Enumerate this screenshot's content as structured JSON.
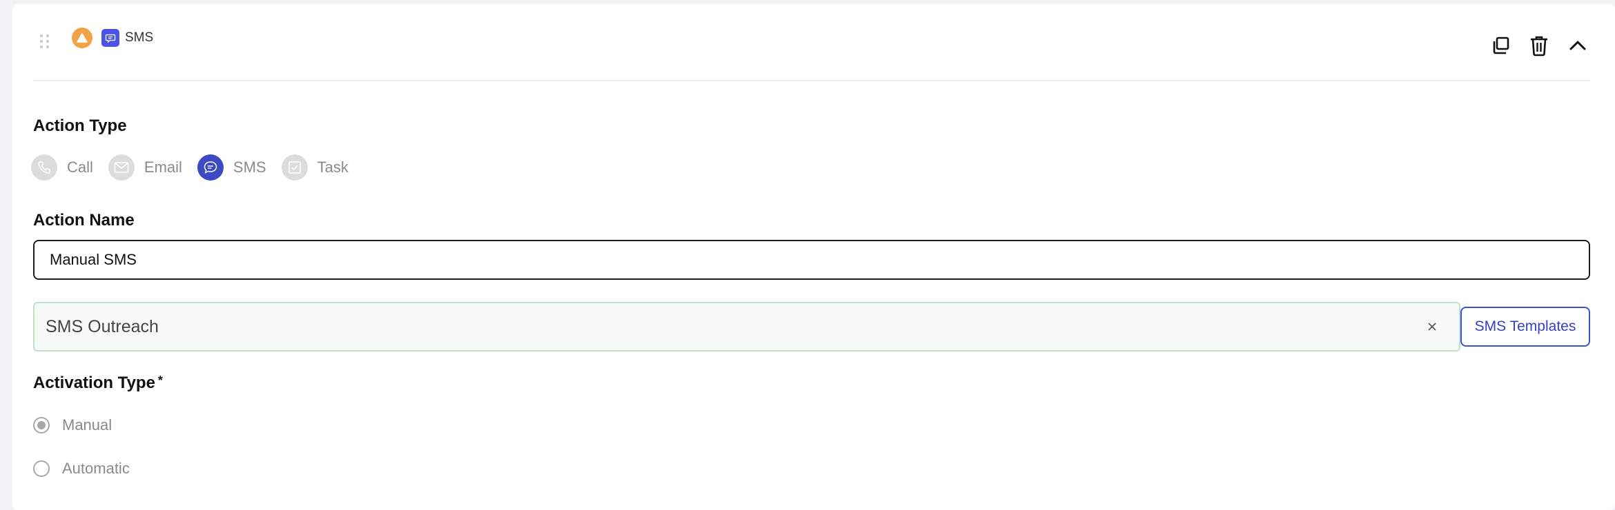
{
  "header": {
    "title": "SMS",
    "icons": {
      "status": "warning-triangle-icon",
      "type": "sms-chat-icon",
      "duplicate": "copy-icon",
      "delete": "trash-icon",
      "collapse": "chevron-up-icon"
    },
    "colors": {
      "status": "#f0a347",
      "type": "#4a55e8"
    }
  },
  "action_type": {
    "label": "Action Type",
    "options": [
      {
        "label": "Call",
        "icon": "phone-icon",
        "selected": false
      },
      {
        "label": "Email",
        "icon": "mail-icon",
        "selected": false
      },
      {
        "label": "SMS",
        "icon": "chat-bubble-icon",
        "selected": true
      },
      {
        "label": "Task",
        "icon": "checkbox-icon",
        "selected": false
      }
    ],
    "active_color": "#3c4bc4"
  },
  "action_name": {
    "label": "Action Name",
    "value": "Manual SMS"
  },
  "template": {
    "value": "SMS Outreach",
    "clear_icon": "close-icon",
    "button_label": "SMS Templates"
  },
  "activation_type": {
    "label": "Activation Type",
    "required_mark": "*",
    "options": [
      {
        "label": "Manual",
        "selected": true
      },
      {
        "label": "Automatic",
        "selected": false
      }
    ]
  }
}
